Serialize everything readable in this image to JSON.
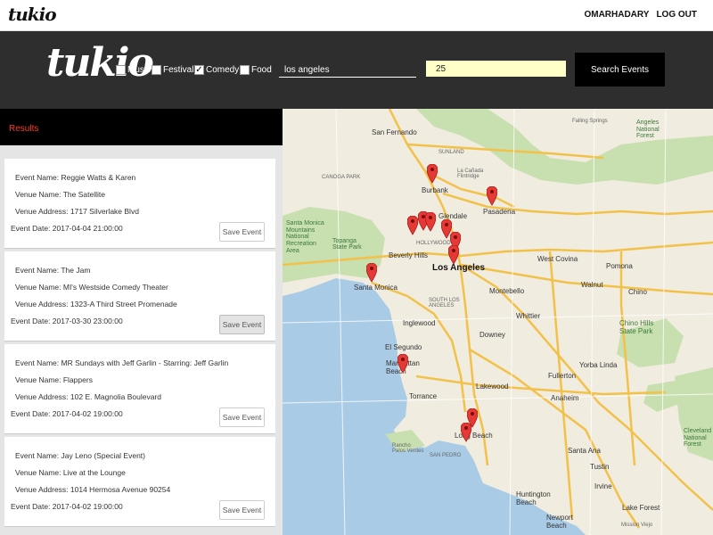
{
  "app": {
    "logo_small": "tukio",
    "logo_big": "tukio"
  },
  "user": {
    "username": "OMARHADARY",
    "logout": "LOG OUT"
  },
  "search": {
    "categories": [
      {
        "label": "Music",
        "checked": false
      },
      {
        "label": "Festivals",
        "checked": false
      },
      {
        "label": "Comedy",
        "checked": true
      },
      {
        "label": "Food",
        "checked": false
      }
    ],
    "location_value": "los angeles",
    "radius_value": "25",
    "button_label": "Search Events"
  },
  "results": {
    "heading": "Results",
    "events": [
      {
        "name": "Event Name: Reggie Watts & Karen",
        "venue": "Venue Name: The Satellite",
        "address": "Venue Address: 1717 Silverlake Blvd",
        "date": "Event Date: 2017-04-04 21:00:00",
        "save_label": "Save Event"
      },
      {
        "name": "Event Name: The Jam",
        "venue": "Venue Name: MI's Westside Comedy Theater",
        "address": "Venue Address: 1323-A Third Street Promenade",
        "date": "Event Date: 2017-03-30 23:00:00",
        "save_label": "Save Event"
      },
      {
        "name": "Event Name: MR Sundays with Jeff Garlin - Starring: Jeff Garlin",
        "venue": "Venue Name: Flappers",
        "address": "Venue Address: 102 E. Magnolia Boulevard",
        "date": "Event Date: 2017-04-02 19:00:00",
        "save_label": "Save Event"
      },
      {
        "name": "Event Name: Jay Leno (Special Event)",
        "venue": "Venue Name: Live at the Lounge",
        "address": "Venue Address: 1014 Hermosa Avenue 90254",
        "date": "Event Date: 2017-04-02 19:00:00",
        "save_label": "Save Event"
      }
    ]
  },
  "map": {
    "labels": {
      "san_fernando": "San Fernando",
      "burbank": "Burbank",
      "la_canada": "La Cañada\nFlintridge",
      "pasadena": "Pasadena",
      "glendale": "Glendale",
      "los_angeles": "Los Angeles",
      "beverly_hills": "Beverly Hills",
      "hollywood": "HOLLYWOOD",
      "santa_monica": "Santa Monica",
      "west_covina": "West Covina",
      "pomona": "Pomona",
      "montebello": "Montebello",
      "chino": "Chino",
      "chino_hills": "Chino Hills\nState Park",
      "inglewood": "Inglewood",
      "downey": "Downey",
      "el_segundo": "El Segundo",
      "manhattan_beach": "Manhattan\nBeach",
      "torrance": "Torrance",
      "lakewood": "Lakewood",
      "fullerton": "Fullerton",
      "yorba_linda": "Yorba Linda",
      "anaheim": "Anaheim",
      "long_beach": "Long Beach",
      "rancho_palos_verdes": "Rancho\nPalos Verdes",
      "san_pedro": "SAN PEDRO",
      "santa_ana": "Santa Ana",
      "irvine": "Irvine",
      "huntington_beach": "Huntington\nBeach",
      "newport_beach": "Newport\nBeach",
      "lake_forest": "Lake Forest",
      "topanga": "Topanga\nState Park",
      "santa_monica_mountains": "Santa Monica\nMountains\nNational\nRecreation\nArea",
      "angeles_forest": "Angeles\nNational\nForest",
      "falling_springs": "Falling Springs",
      "sunland": "SUNLAND",
      "mission_viejo": "Mission Viejo",
      "canoga_park": "CANOGA PARK",
      "south_los_angeles": "SOUTH LOS\nANGELES",
      "cleveland": "Cleveland\nNational\nForest",
      "walnut": "Walnut",
      "tustin": "Tustin",
      "whittier": "Whittier"
    }
  }
}
